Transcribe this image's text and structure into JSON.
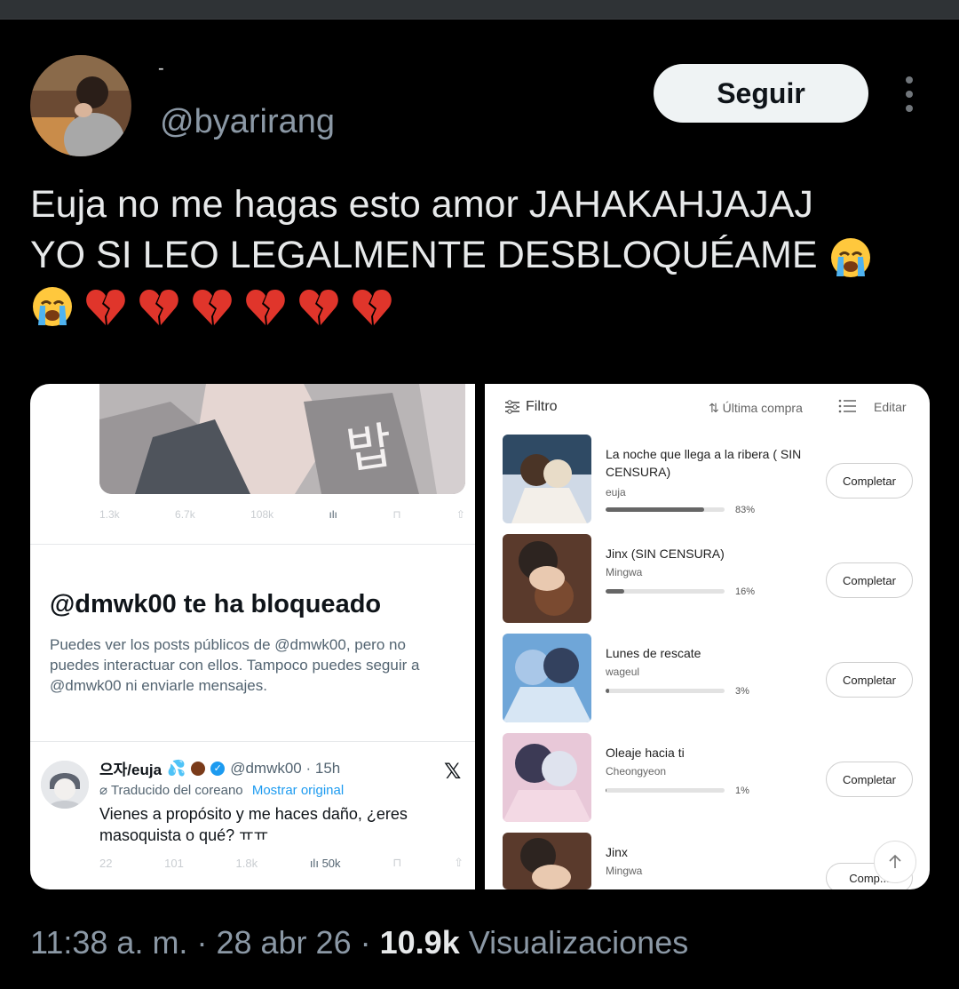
{
  "tweet": {
    "display_name": "-",
    "handle": "@byarirang",
    "follow_label": "Seguir",
    "text_line1": "Euja no me hagas esto amor JAHAKAHJAJAJ",
    "text_line2": "YO SI LEO LEGALMENTE DESBLOQUÉAME",
    "emojis": [
      "loudly-crying-face",
      "loudly-crying-face",
      "broken-heart",
      "broken-heart",
      "broken-heart",
      "broken-heart",
      "broken-heart",
      "broken-heart"
    ],
    "time": "11:38 a. m.",
    "sep": "·",
    "date": "28 abr 26",
    "views_count": "10.9k",
    "views_label": "Visualizaciones"
  },
  "left_screenshot": {
    "art_text": "밥",
    "faint_counts": [
      "1.3k",
      "6.7k",
      "108k"
    ],
    "block_title": "@dmwk00 te ha bloqueado",
    "block_desc": "Puedes ver los posts públicos de @dmwk00, pero no puedes interactuar con ellos. Tampoco puedes seguir a @dmwk00 ni enviarle mensajes.",
    "reply": {
      "name": "으자/euja",
      "handle_time": "@dmwk00 · 15h",
      "translated": "Traducido del coreano",
      "show_original": "Mostrar original",
      "text": "Vienes a propósito y me haces daño, ¿eres masoquista o qué? ㅠㅠ",
      "counts": [
        "22",
        "101",
        "1.8k"
      ],
      "views": "50k"
    }
  },
  "right_screenshot": {
    "filter_label": "Filtro",
    "sort_label": "⇅ Última compra",
    "edit_label": "Editar",
    "complete_label": "Completar",
    "books": [
      {
        "title": "La noche que llega a la ribera ( SIN CENSURA)",
        "author": "euja",
        "progress": 0.83,
        "progress_text": "83%"
      },
      {
        "title": "Jinx (SIN CENSURA)",
        "author": "Mingwa",
        "progress": 0.16,
        "progress_text": "16%"
      },
      {
        "title": "Lunes de rescate",
        "author": "wageul",
        "progress": 0.03,
        "progress_text": "3%"
      },
      {
        "title": "Oleaje hacia ti",
        "author": "Cheongyeon",
        "progress": 0.01,
        "progress_text": "1%"
      },
      {
        "title": "Jinx",
        "author": "Mingwa",
        "complete_partial": "Comp..."
      }
    ]
  },
  "colors": {
    "background": "#000000",
    "text_primary": "#e7e9ea",
    "text_secondary": "#8b98a5",
    "follow_bg": "#eff3f4",
    "link_blue": "#1d9bf0"
  }
}
